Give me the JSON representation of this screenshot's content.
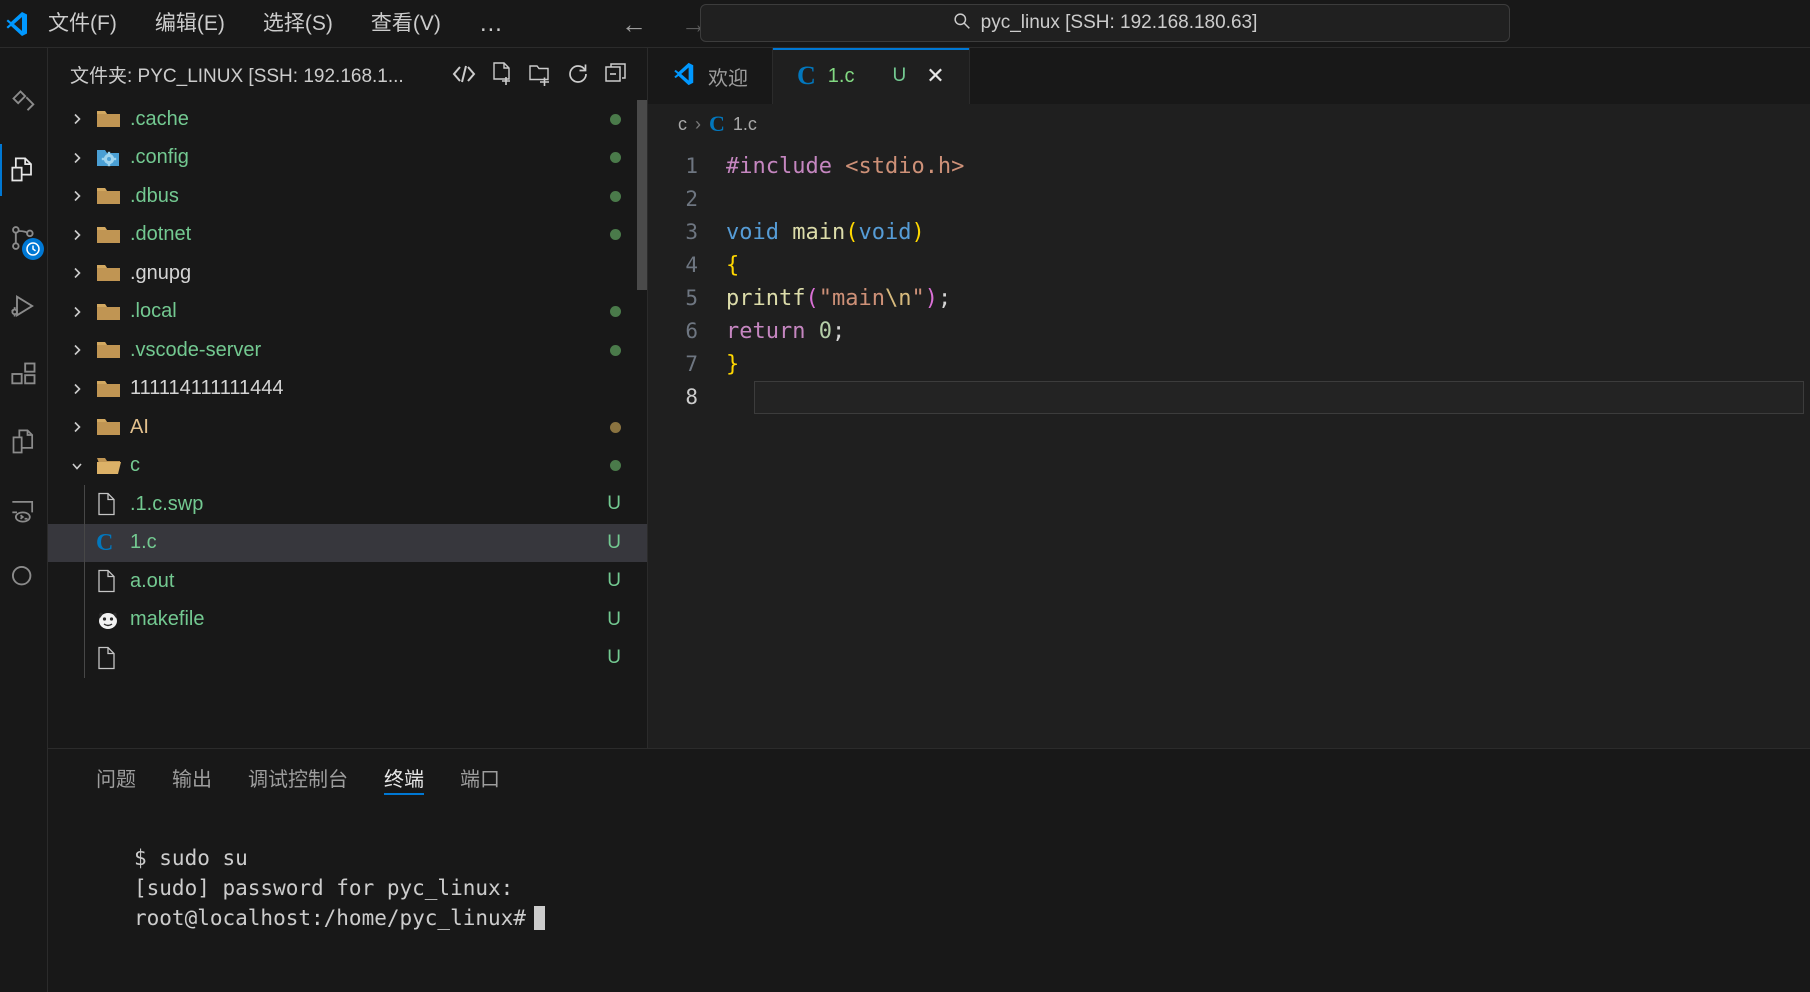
{
  "titlebar": {
    "logo_icon": "vscode-logo-icon",
    "menus": [
      {
        "label": "文件(F)",
        "name": "menu-file"
      },
      {
        "label": "编辑(E)",
        "name": "menu-edit"
      },
      {
        "label": "选择(S)",
        "name": "menu-selection"
      },
      {
        "label": "查看(V)",
        "name": "menu-view"
      },
      {
        "label": "…",
        "name": "menu-more"
      }
    ],
    "nav_back": "←",
    "nav_forward": "→",
    "search": {
      "icon": "search-icon",
      "text": "pyc_linux [SSH: 192.168.180.63]"
    }
  },
  "activitybar": {
    "items": [
      {
        "name": "remote-explorer-icon",
        "active": false
      },
      {
        "name": "explorer-icon",
        "active": true
      },
      {
        "name": "source-control-icon",
        "active": false,
        "badge": "clock"
      },
      {
        "name": "run-and-debug-icon",
        "active": false
      },
      {
        "name": "extensions-icon",
        "active": false
      },
      {
        "name": "open-editors-icon",
        "active": false
      },
      {
        "name": "remote-window-icon",
        "active": false
      },
      {
        "name": "search-icon",
        "active": false
      }
    ]
  },
  "sidebar": {
    "title": "文件夹: PYC_LINUX [SSH: 192.168.1...",
    "actions": [
      {
        "name": "source-control-compare-icon",
        "glyph": "<>"
      },
      {
        "name": "new-file-icon",
        "glyph": "new-file"
      },
      {
        "name": "new-folder-icon",
        "glyph": "new-folder"
      },
      {
        "name": "refresh-explorer-icon",
        "glyph": "refresh"
      },
      {
        "name": "collapse-folders-icon",
        "glyph": "collapse"
      }
    ],
    "tree": [
      {
        "label": ".cache",
        "type": "folder",
        "expanded": false,
        "depth": 0,
        "color": "#73c991",
        "status": "dot",
        "status_color": "#4a7a4a"
      },
      {
        "label": ".config",
        "type": "folder-config",
        "expanded": false,
        "depth": 0,
        "color": "#73c991",
        "status": "dot",
        "status_color": "#4a7a4a"
      },
      {
        "label": ".dbus",
        "type": "folder",
        "expanded": false,
        "depth": 0,
        "color": "#73c991",
        "status": "dot",
        "status_color": "#4a7a4a"
      },
      {
        "label": ".dotnet",
        "type": "folder",
        "expanded": false,
        "depth": 0,
        "color": "#73c991",
        "status": "dot",
        "status_color": "#4a7a4a"
      },
      {
        "label": ".gnupg",
        "type": "folder",
        "expanded": false,
        "depth": 0,
        "color": "#d4d4d4",
        "status": "",
        "status_color": ""
      },
      {
        "label": ".local",
        "type": "folder",
        "expanded": false,
        "depth": 0,
        "color": "#73c991",
        "status": "dot",
        "status_color": "#4a7a4a"
      },
      {
        "label": ".vscode-server",
        "type": "folder",
        "expanded": false,
        "depth": 0,
        "color": "#73c991",
        "status": "dot",
        "status_color": "#4a7a4a"
      },
      {
        "label": "111114111111444",
        "type": "folder",
        "expanded": false,
        "depth": 0,
        "color": "#d4d4d4",
        "status": "",
        "status_color": ""
      },
      {
        "label": "AI",
        "type": "folder",
        "expanded": false,
        "depth": 0,
        "color": "#e2c08d",
        "status": "dot",
        "status_color": "#8a7340"
      },
      {
        "label": "c",
        "type": "folder",
        "expanded": true,
        "depth": 0,
        "color": "#73c991",
        "status": "dot",
        "status_color": "#4a7a4a"
      },
      {
        "label": ".1.c.swp",
        "type": "file",
        "expanded": null,
        "depth": 1,
        "color": "#73c991",
        "status": "U",
        "status_color": "#73c991"
      },
      {
        "label": "1.c",
        "type": "file-c",
        "expanded": null,
        "depth": 1,
        "color": "#73c991",
        "status": "U",
        "status_color": "#73c991",
        "selected": true
      },
      {
        "label": "a.out",
        "type": "file",
        "expanded": null,
        "depth": 1,
        "color": "#73c991",
        "status": "U",
        "status_color": "#73c991"
      },
      {
        "label": "makefile",
        "type": "file-make",
        "expanded": null,
        "depth": 1,
        "color": "#73c991",
        "status": "U",
        "status_color": "#73c991"
      },
      {
        "label": "",
        "type": "file",
        "expanded": null,
        "depth": 1,
        "color": "#73c991",
        "status": "U",
        "status_color": "#73c991"
      }
    ]
  },
  "editor": {
    "tabs": [
      {
        "label": "欢迎",
        "icon": "vscode-logo-icon",
        "active": false,
        "name": "tab-welcome"
      },
      {
        "label": "1.c",
        "icon": "c-file-icon",
        "active": true,
        "badge": "U",
        "close": "✕",
        "name": "tab-1-c"
      }
    ],
    "breadcrumb": {
      "folder": "c",
      "separator": "›",
      "file": "1.c",
      "icon": "c-file-icon"
    },
    "lines": [
      {
        "n": "1",
        "tokens": [
          {
            "t": "#include ",
            "c": "t-pre"
          },
          {
            "t": "<stdio.h>",
            "c": "t-str"
          }
        ]
      },
      {
        "n": "2",
        "tokens": []
      },
      {
        "n": "3",
        "tokens": [
          {
            "t": "void ",
            "c": "t-key"
          },
          {
            "t": "main",
            "c": "t-fn"
          },
          {
            "t": "(",
            "c": "t-punc"
          },
          {
            "t": "void",
            "c": "t-key"
          },
          {
            "t": ")",
            "c": "t-punc"
          }
        ]
      },
      {
        "n": "4",
        "tokens": [
          {
            "t": "{",
            "c": "t-punc"
          }
        ]
      },
      {
        "n": "5",
        "tokens": [
          {
            "t": "printf",
            "c": "t-fn"
          },
          {
            "t": "(",
            "c": "t-punc2"
          },
          {
            "t": "\"main",
            "c": "t-str"
          },
          {
            "t": "\\n",
            "c": "t-esc"
          },
          {
            "t": "\"",
            "c": "t-str"
          },
          {
            "t": ")",
            "c": "t-punc2"
          },
          {
            "t": ";",
            "c": "t-plain"
          }
        ]
      },
      {
        "n": "6",
        "tokens": [
          {
            "t": "return ",
            "c": "t-ctl"
          },
          {
            "t": "0",
            "c": "t-num"
          },
          {
            "t": ";",
            "c": "t-plain"
          }
        ]
      },
      {
        "n": "7",
        "tokens": [
          {
            "t": "}",
            "c": "t-punc"
          }
        ]
      },
      {
        "n": "8",
        "tokens": [],
        "active": true
      }
    ]
  },
  "panel": {
    "tabs": [
      {
        "label": "问题",
        "active": false,
        "name": "panel-tab-problems"
      },
      {
        "label": "输出",
        "active": false,
        "name": "panel-tab-output"
      },
      {
        "label": "调试控制台",
        "active": false,
        "name": "panel-tab-debug-console"
      },
      {
        "label": "终端",
        "active": true,
        "name": "panel-tab-terminal"
      },
      {
        "label": "端口",
        "active": false,
        "name": "panel-tab-ports"
      }
    ],
    "terminal_lines": [
      "$ sudo su",
      "[sudo] password for pyc_linux:",
      "root@localhost:/home/pyc_linux#"
    ]
  },
  "colors": {
    "accent": "#0078d4",
    "untracked_green": "#73c991",
    "modified_orange": "#e2c08d",
    "background": "#1e1e1e",
    "editor_background": "#1f1f1f",
    "chrome_background": "#181818"
  }
}
